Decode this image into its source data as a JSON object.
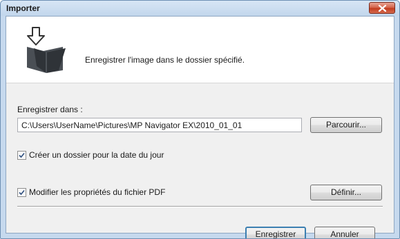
{
  "window": {
    "title": "Importer"
  },
  "banner": {
    "description": "Enregistrer l'image dans le dossier spécifié."
  },
  "save_location": {
    "label": "Enregistrer dans :",
    "path": "C:\\Users\\UserName\\Pictures\\MP Navigator EX\\2010_01_01",
    "browse_label": "Parcourir..."
  },
  "options": {
    "create_date_folder": {
      "label": "Créer un dossier pour la date du jour",
      "checked": true
    },
    "edit_pdf_properties": {
      "label": "Modifier les propriétés du fichier PDF",
      "checked": true
    },
    "define_label": "Définir..."
  },
  "actions": {
    "save_label": "Enregistrer",
    "cancel_label": "Annuler"
  },
  "icons": {
    "close": "close-icon",
    "banner": "import-folder-icon",
    "check": "checkmark-icon"
  },
  "colors": {
    "titlebar": "#c6d9ee",
    "close_button": "#c23c1f",
    "default_button_border": "#3c7fb1"
  }
}
